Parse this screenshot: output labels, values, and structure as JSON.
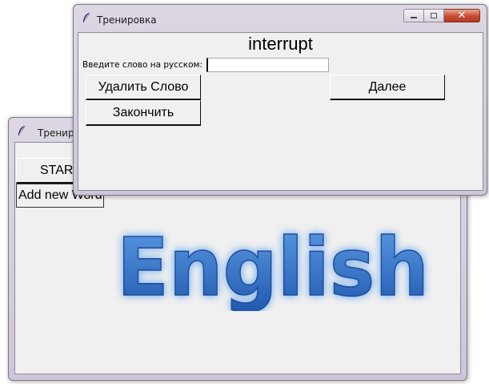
{
  "back_window": {
    "title": "Тренировка",
    "start_button": "START",
    "add_word_button": "Add new Word",
    "logo_text": "English"
  },
  "front_window": {
    "title": "Тренировка",
    "current_word": "interrupt",
    "prompt_label": "Введите слово на русском:",
    "answer_value": "",
    "delete_button": "Удалить Слово",
    "next_button": "Далее",
    "finish_button": "Закончить"
  },
  "icons": [
    "feather-icon",
    "minimize-icon",
    "maximize-icon",
    "close-icon"
  ],
  "colors": {
    "client_bg": "#f0f0f0",
    "titlebar": "#d6cfdd",
    "close_button": "#c74a33",
    "logo_blue": "#2a6cc4",
    "logo_glow": "#7fb0ea"
  }
}
